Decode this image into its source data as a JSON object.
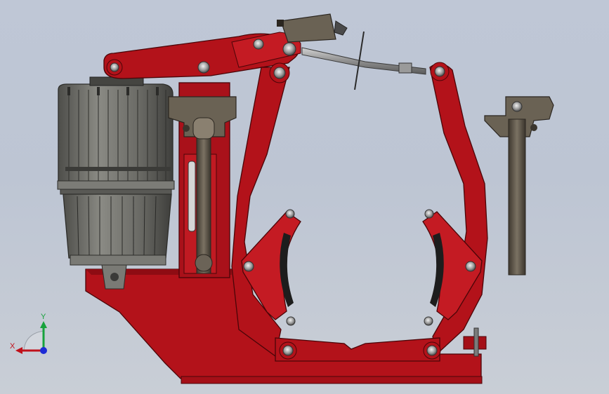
{
  "viewport": {
    "background_top": "#bfc7d6",
    "background_bottom": "#c9ced6"
  },
  "model": {
    "frame_color": "#b3121a",
    "frame_dark": "#6f0a10",
    "metal_color": "#5e574b",
    "motor_color": "#6f6f6a"
  },
  "triad": {
    "x_label": "X",
    "y_label": "Y",
    "x_color": "#c0101a",
    "y_color": "#17a23c",
    "z_color": "#1d2bd6"
  }
}
